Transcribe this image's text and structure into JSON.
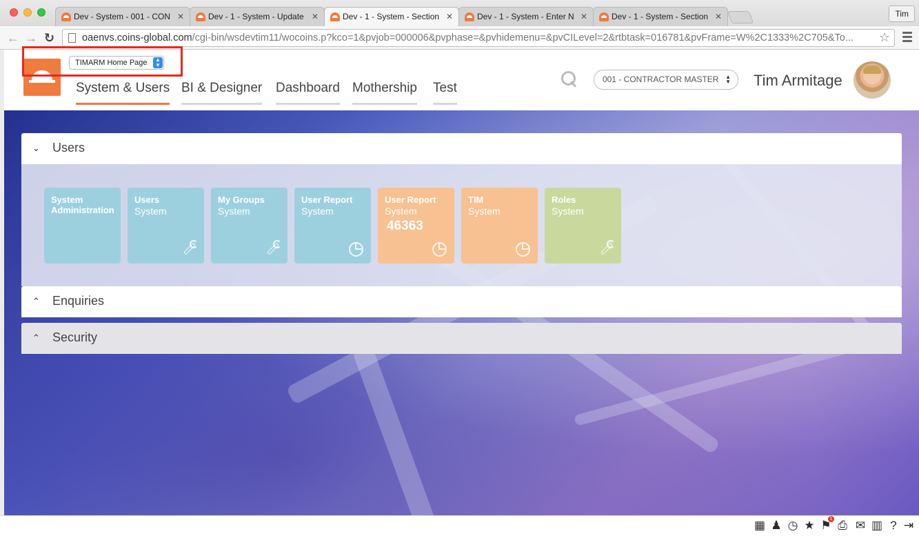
{
  "browser": {
    "tabs": [
      {
        "title": "Dev - System - 001 - CON",
        "active": false
      },
      {
        "title": "Dev - 1 - System - Update",
        "active": false
      },
      {
        "title": "Dev - 1 - System - Section",
        "active": true
      },
      {
        "title": "Dev - 1 - System - Enter N",
        "active": false
      },
      {
        "title": "Dev - 1 - System - Section",
        "active": false
      }
    ],
    "profile": "Tim",
    "url_host": "oaenvs.coins-global.com",
    "url_path": "/cgi-bin/wsdevtim11/wocoins.p?kco=1&pvjob=000006&pvphase=&pvhidemenu=&pvCILevel=2&rtbtask=016781&pvFrame=W%2C1333%2C705&To..."
  },
  "header": {
    "page_select_value": "TIMARM Home Page",
    "nav": [
      "System & Users",
      "BI & Designer",
      "Dashboard",
      "Mothership",
      "Test"
    ],
    "active_nav": "System & Users",
    "company_select_value": "001 - CONTRACTOR MASTER",
    "user_name": "Tim Armitage"
  },
  "panels": {
    "users": {
      "label": "Users",
      "expanded": true,
      "tiles": [
        {
          "line1": "System",
          "line2": "",
          "line1b": "Administration",
          "value": "",
          "color": "blue",
          "icon": ""
        },
        {
          "line1": "Users",
          "line2": "System",
          "value": "",
          "color": "blue",
          "icon": "wrench-icon"
        },
        {
          "line1": "My Groups",
          "line2": "System",
          "value": "",
          "color": "blue",
          "icon": "wrench-icon"
        },
        {
          "line1": "User Report",
          "line2": "System",
          "value": "",
          "color": "blue",
          "icon": "pie-chart-icon"
        },
        {
          "line1": "User Report",
          "line2": "System",
          "value": "46363",
          "color": "orange",
          "icon": "pie-chart-icon"
        },
        {
          "line1": "TIM",
          "line2": "System",
          "value": "",
          "color": "orange",
          "icon": "pie-chart-icon"
        },
        {
          "line1": "Roles",
          "line2": "System",
          "value": "",
          "color": "green",
          "icon": "wrench-icon"
        }
      ]
    },
    "enquiries": {
      "label": "Enquiries",
      "expanded": false
    },
    "security": {
      "label": "Security",
      "expanded": false
    }
  },
  "statusbar": {
    "notification_count": "1",
    "icons": [
      "apps-grid-icon",
      "person-icon",
      "history-icon",
      "star-icon",
      "flag-icon",
      "printer-icon",
      "mail-icon",
      "library-icon",
      "help-icon",
      "logout-icon"
    ]
  },
  "colors": {
    "brand_orange": "#f07b3f",
    "tile_blue": "#9dd0df",
    "tile_orange": "#f7c191",
    "tile_green": "#c9d99d",
    "highlight_red": "#e8291c"
  }
}
